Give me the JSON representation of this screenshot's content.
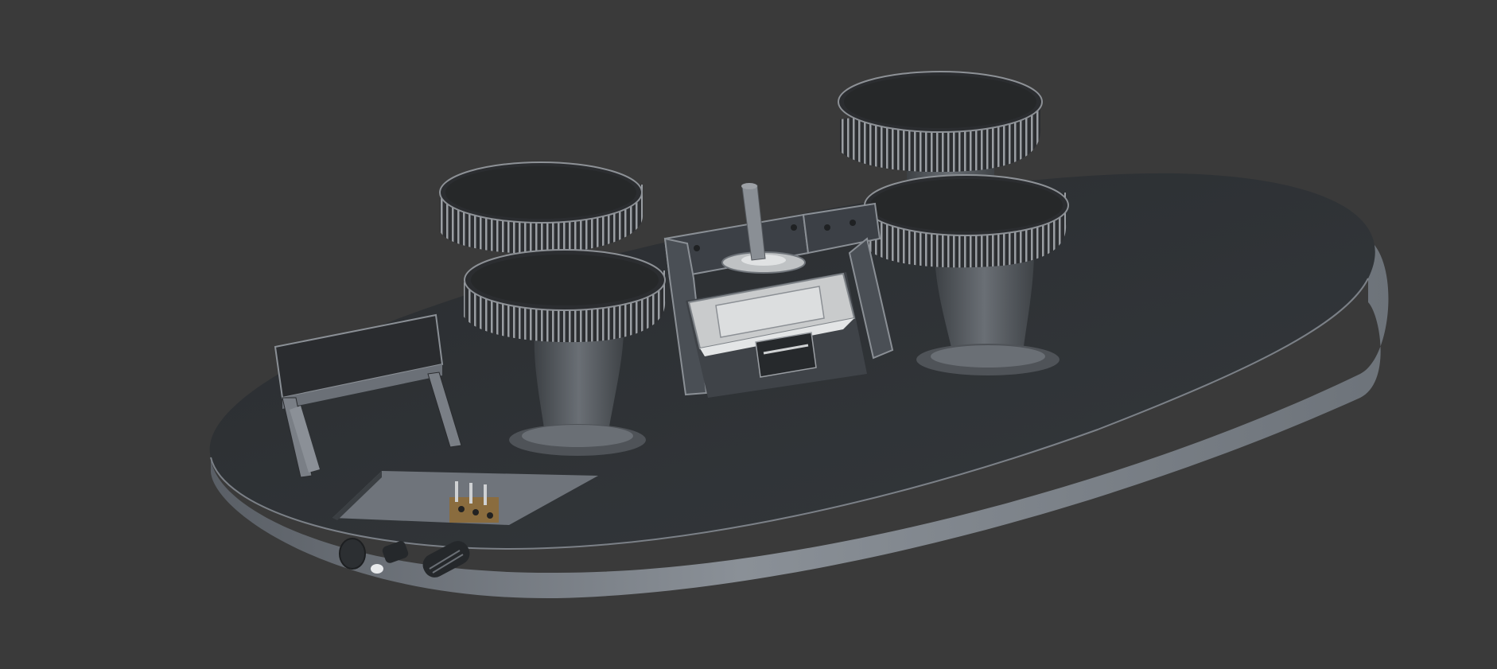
{
  "viewport": {
    "background_color": "#3a3a3a",
    "model": {
      "base_plate_top_color": "#2d3033",
      "base_plate_side_color": "#6f747a",
      "gear_color": "#2b2d30",
      "spindle_color": "#54585d",
      "motor_bracket_color": "#454a50",
      "motor_body_color": "#c9cbcc"
    }
  }
}
